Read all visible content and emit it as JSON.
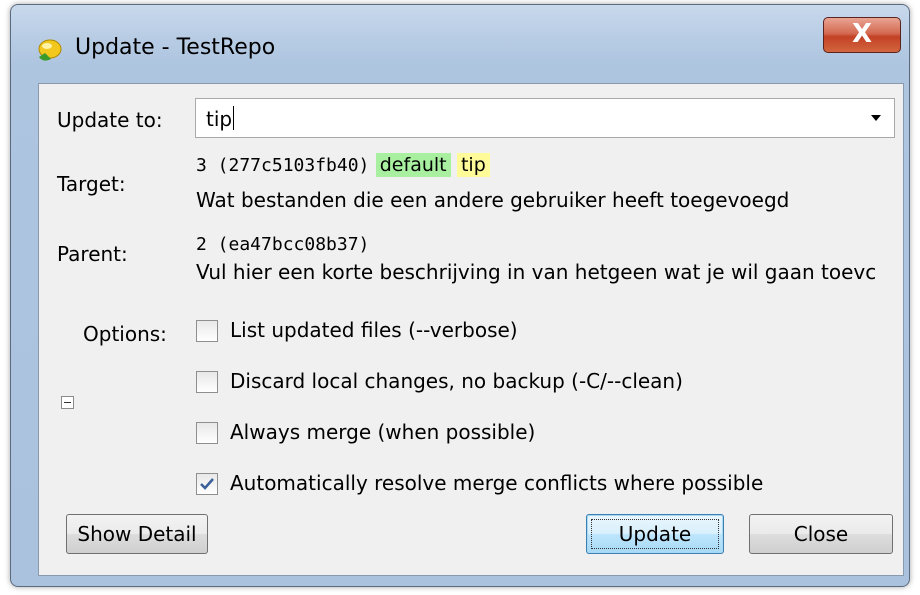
{
  "window": {
    "title": "Update - TestRepo",
    "close_label": "X"
  },
  "form": {
    "update_to_label": "Update to:",
    "update_to_value": "tip",
    "target_label": "Target:",
    "target_rev": "3 (277c5103fb40)",
    "target_branch": "default",
    "target_tag": "tip",
    "target_desc": "Wat bestanden die een andere gebruiker heeft toegevoegd",
    "parent_label": "Parent:",
    "parent_rev": "2 (ea47bcc08b37)",
    "parent_desc": "Vul hier een korte beschrijving in van hetgeen wat je wil gaan toevc",
    "options_label": "Options:"
  },
  "options": [
    {
      "label": "List updated files (--verbose)",
      "checked": false
    },
    {
      "label": "Discard local changes, no backup (-C/--clean)",
      "checked": false
    },
    {
      "label": "Always merge (when possible)",
      "checked": false
    },
    {
      "label": "Automatically resolve merge conflicts where possible",
      "checked": true
    }
  ],
  "buttons": {
    "show_detail": "Show Detail",
    "update": "Update",
    "close": "Close"
  },
  "colors": {
    "branch_tag_bg": "#a8f0a0",
    "tip_tag_bg": "#fffb99",
    "close_button": "#c34125"
  }
}
